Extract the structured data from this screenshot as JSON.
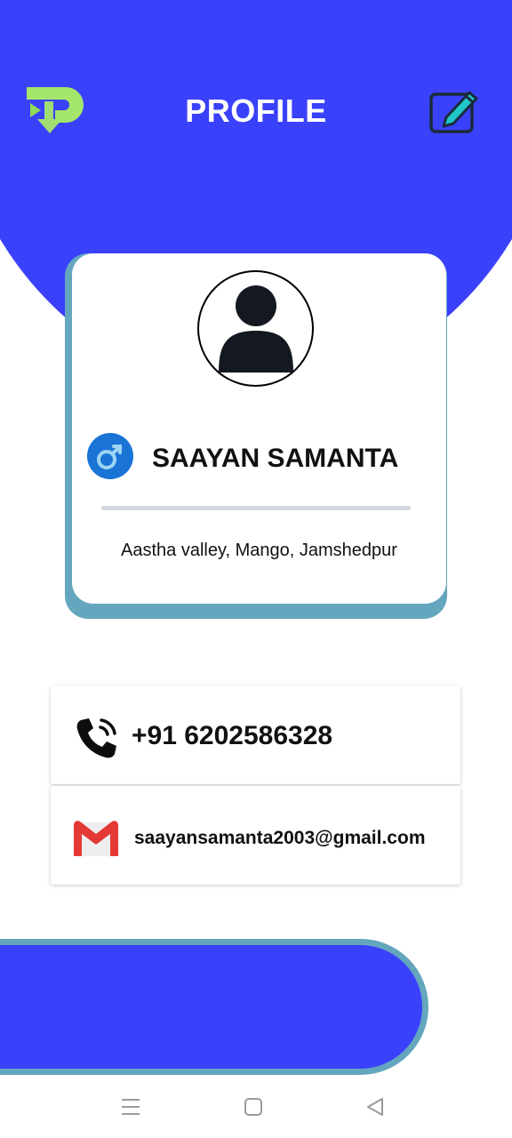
{
  "colors": {
    "brand_blue": "#3a41fb",
    "card_shadow": "#64a6be",
    "status_dot": "#2ecc71",
    "logo_green": "#a4e56c",
    "edit_teal": "#1fc6c6"
  },
  "header": {
    "title": "PROFILE",
    "logo_icon": "app-logo-p-arrow",
    "edit_icon": "edit-pencil-icon"
  },
  "profile": {
    "avatar_icon": "user-avatar-icon",
    "gender_icon": "male-icon",
    "name": "SAAYAN SAMANTA",
    "address": "Aastha valley, Mango, Jamshedpur"
  },
  "contact": {
    "phone_icon": "phone-icon",
    "phone": "+91 6202586328",
    "email_icon": "gmail-icon",
    "email": "saayansamanta2003@gmail.com"
  },
  "nav": {
    "menu_icon": "menu-icon",
    "home_icon": "home-square-icon",
    "back_icon": "back-triangle-icon"
  }
}
